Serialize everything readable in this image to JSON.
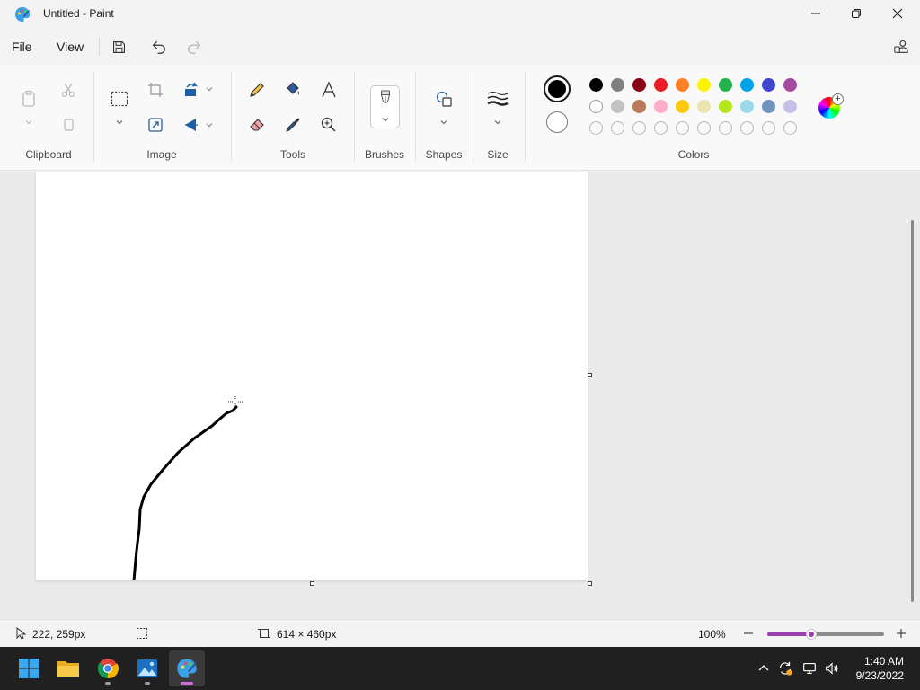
{
  "window": {
    "title": "Untitled - Paint"
  },
  "menu": {
    "file": "File",
    "view": "View"
  },
  "ribbon": {
    "groups": {
      "clipboard": "Clipboard",
      "image": "Image",
      "tools": "Tools",
      "brushes": "Brushes",
      "shapes": "Shapes",
      "size": "Size",
      "colors": "Colors"
    },
    "primary_color": "#000000",
    "secondary_color": "#ffffff",
    "palette_row1": [
      "#000000",
      "#7f7f7f",
      "#880015",
      "#ed1c24",
      "#ff7f27",
      "#fff200",
      "#22b14c",
      "#00a2e8",
      "#3f48cc",
      "#a349a4"
    ],
    "palette_row2": [
      "#ffffff",
      "#c3c3c3",
      "#b97a57",
      "#ffaec9",
      "#ffc90e",
      "#efe4b0",
      "#b5e61d",
      "#99d9ea",
      "#7092be",
      "#c8bfe7"
    ],
    "palette_row3_count": 10
  },
  "status": {
    "cursor_position": "222, 259px",
    "canvas_size": "614 × 460px",
    "zoom": "100%",
    "zoom_fraction": 0.38
  },
  "taskbar": {
    "time": "1:40 AM",
    "date": "9/23/2022"
  },
  "icons": {
    "minimize": "minimize-icon",
    "maximize": "restore-icon",
    "close": "close-icon",
    "save": "save-icon",
    "undo": "undo-icon",
    "redo": "redo-icon",
    "account": "account-icon"
  }
}
